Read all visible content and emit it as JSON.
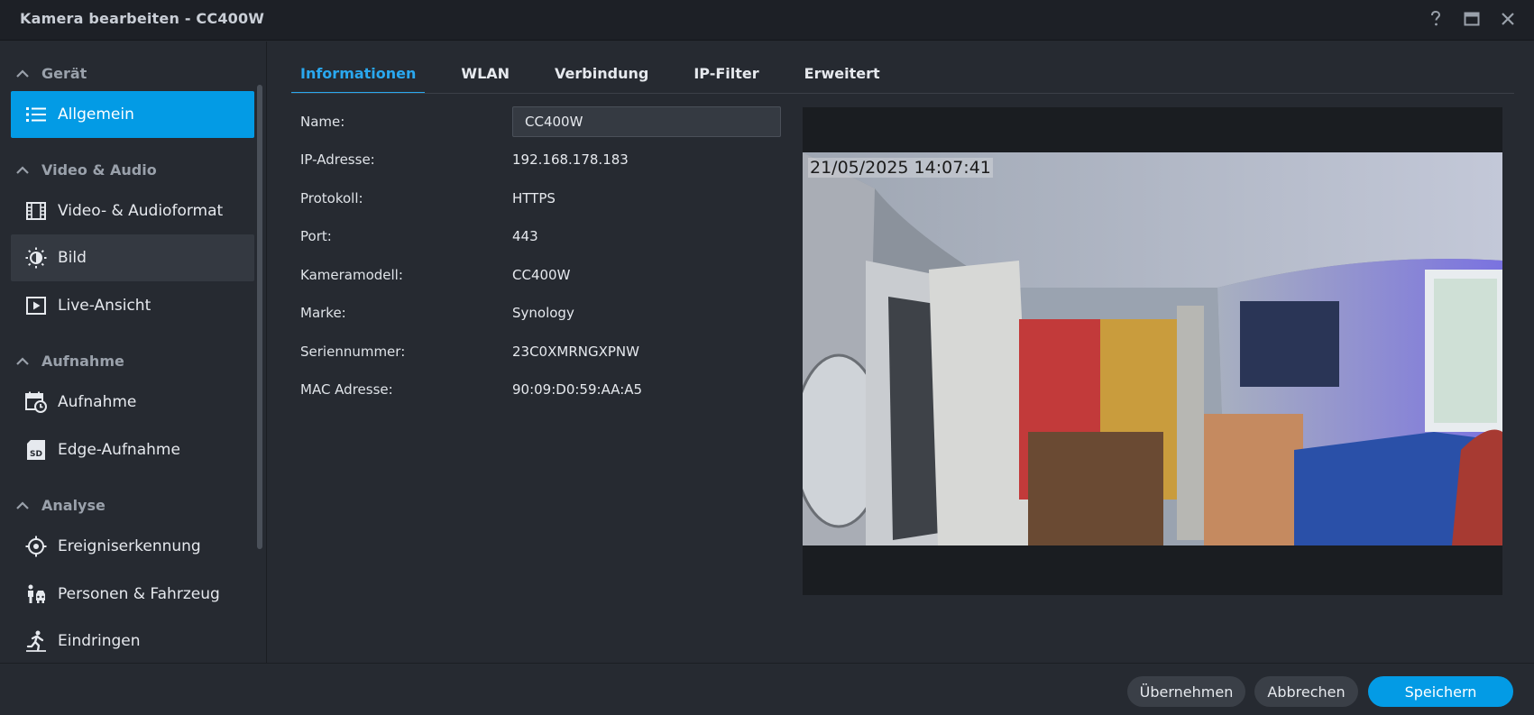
{
  "window": {
    "title": "Kamera bearbeiten - CC400W",
    "controls": [
      {
        "name": "help-icon",
        "glyph": "?"
      },
      {
        "name": "maximize-icon",
        "glyph": "▭"
      },
      {
        "name": "close-icon",
        "glyph": "✕"
      }
    ]
  },
  "sidebar": {
    "sections": [
      {
        "label": "Gerät",
        "items": [
          {
            "label": "Allgemein",
            "icon": "list-icon",
            "state": "active"
          }
        ]
      },
      {
        "label": "Video & Audio",
        "items": [
          {
            "label": "Video- & Audioformat",
            "icon": "film-icon",
            "state": "normal"
          },
          {
            "label": "Bild",
            "icon": "brightness-icon",
            "state": "hover"
          },
          {
            "label": "Live-Ansicht",
            "icon": "play-square-icon",
            "state": "normal"
          }
        ]
      },
      {
        "label": "Aufnahme",
        "items": [
          {
            "label": "Aufnahme",
            "icon": "calendar-clock-icon",
            "state": "normal"
          },
          {
            "label": "Edge-Aufnahme",
            "icon": "sd-card-icon",
            "state": "normal"
          }
        ]
      },
      {
        "label": "Analyse",
        "items": [
          {
            "label": "Ereigniserkennung",
            "icon": "crosshair-icon",
            "state": "normal"
          },
          {
            "label": "Personen & Fahrzeug",
            "icon": "person-vehicle-icon",
            "state": "normal"
          },
          {
            "label": "Eindringen",
            "icon": "running-person-icon",
            "state": "normal"
          }
        ]
      }
    ]
  },
  "tabs": [
    {
      "label": "Informationen",
      "active": true
    },
    {
      "label": "WLAN",
      "active": false
    },
    {
      "label": "Verbindung",
      "active": false
    },
    {
      "label": "IP-Filter",
      "active": false
    },
    {
      "label": "Erweitert",
      "active": false
    }
  ],
  "info": {
    "name_label": "Name:",
    "name_value": "CC400W",
    "rows": [
      {
        "label": "IP-Adresse:",
        "value": "192.168.178.183"
      },
      {
        "label": "Protokoll:",
        "value": "HTTPS"
      },
      {
        "label": "Port:",
        "value": "443"
      },
      {
        "label": "Kameramodell:",
        "value": "CC400W"
      },
      {
        "label": "Marke:",
        "value": "Synology"
      },
      {
        "label": "Seriennummer:",
        "value": "23C0XMRNGXPNW"
      },
      {
        "label": "MAC Adresse:",
        "value": "90:09:D0:59:AA:A5"
      }
    ]
  },
  "preview": {
    "timestamp": "21/05/2025 14:07:41"
  },
  "footer": {
    "apply_label": "Übernehmen",
    "cancel_label": "Abbrechen",
    "save_label": "Speichern"
  },
  "colors": {
    "accent": "#039be5",
    "background": "#262a31",
    "titlebar": "#1d2026"
  }
}
